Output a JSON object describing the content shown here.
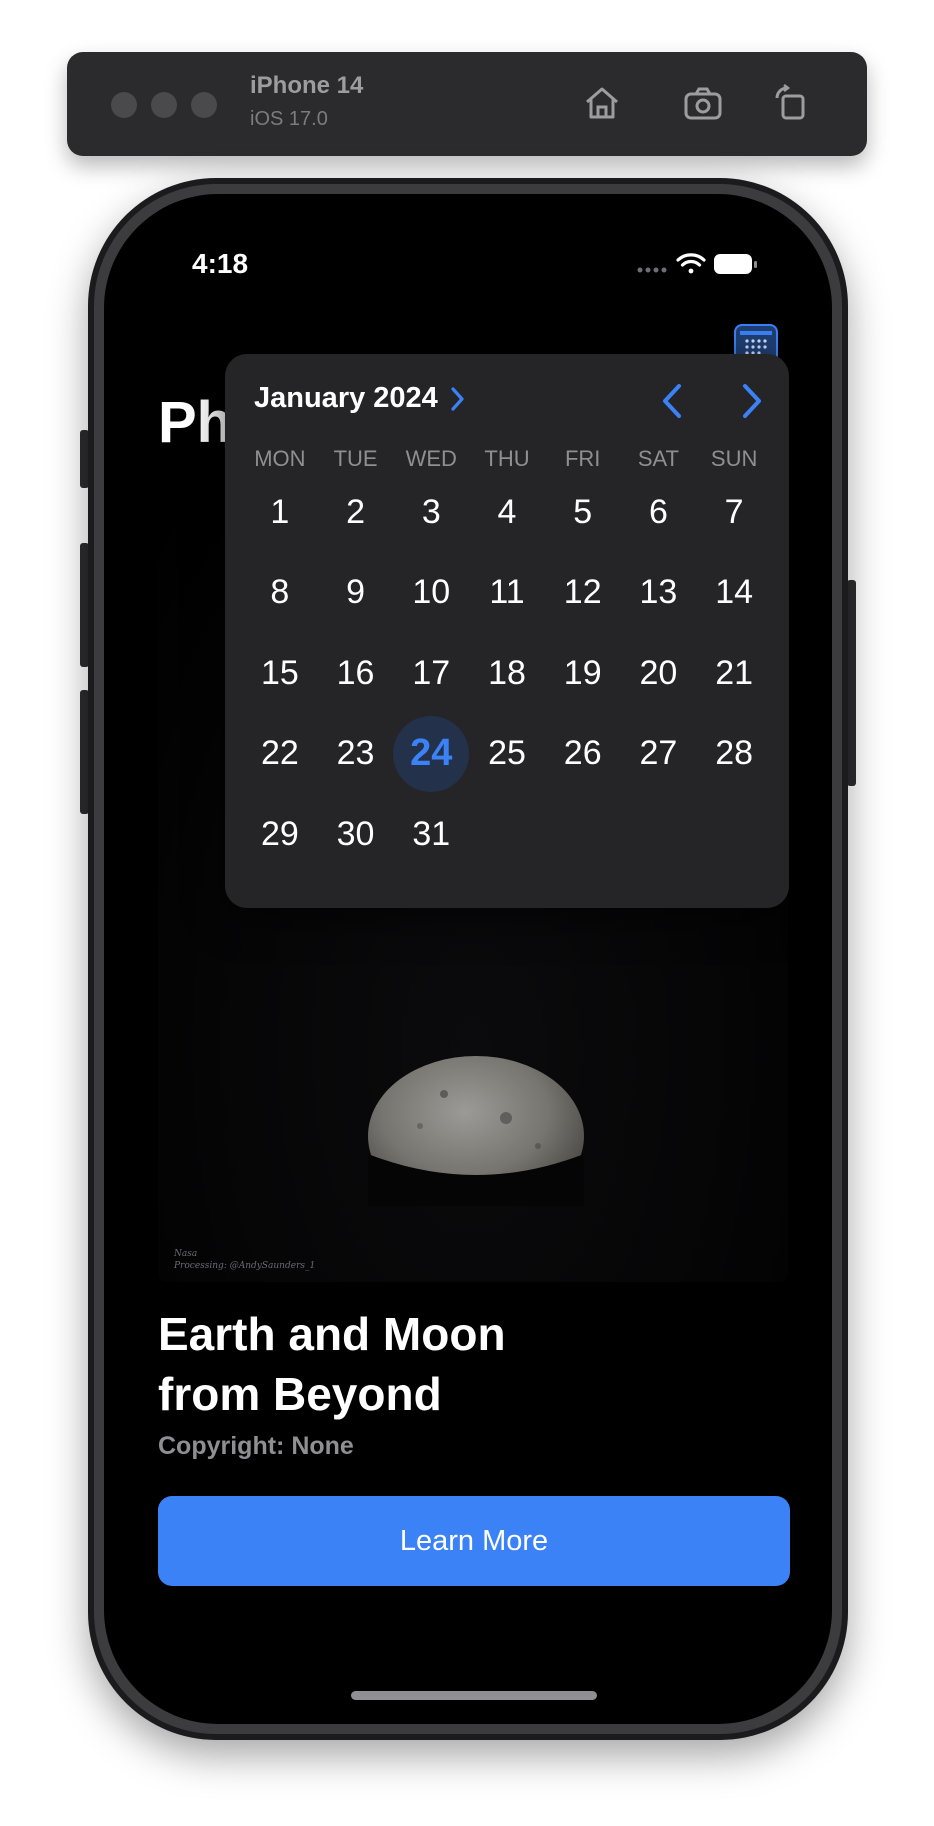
{
  "simulator": {
    "device_name": "iPhone 14",
    "os_version": "iOS 17.0",
    "icons": [
      "home-icon",
      "screenshot-icon",
      "rotate-icon"
    ]
  },
  "status_bar": {
    "time": "4:18",
    "icons": [
      "cellular-icon",
      "wifi-icon",
      "battery-icon"
    ]
  },
  "page": {
    "title_visible": "Ph",
    "calendar_button_icon": "calendar-icon"
  },
  "calendar": {
    "month_label": "January 2024",
    "weekdays": [
      "MON",
      "TUE",
      "WED",
      "THU",
      "FRI",
      "SAT",
      "SUN"
    ],
    "days": [
      "1",
      "2",
      "3",
      "4",
      "5",
      "6",
      "7",
      "8",
      "9",
      "10",
      "11",
      "12",
      "13",
      "14",
      "15",
      "16",
      "17",
      "18",
      "19",
      "20",
      "21",
      "22",
      "23",
      "24",
      "25",
      "26",
      "27",
      "28",
      "29",
      "30",
      "31"
    ],
    "selected_day": "24",
    "accent_color": "#3b82f6"
  },
  "photo": {
    "credit_line_1": "Nasa",
    "credit_line_2": "Processing: @AndySaunders_1"
  },
  "article": {
    "title_line_1": "Earth and Moon",
    "title_line_2": "from Beyond",
    "copyright": "Copyright: None",
    "button_label": "Learn More"
  }
}
